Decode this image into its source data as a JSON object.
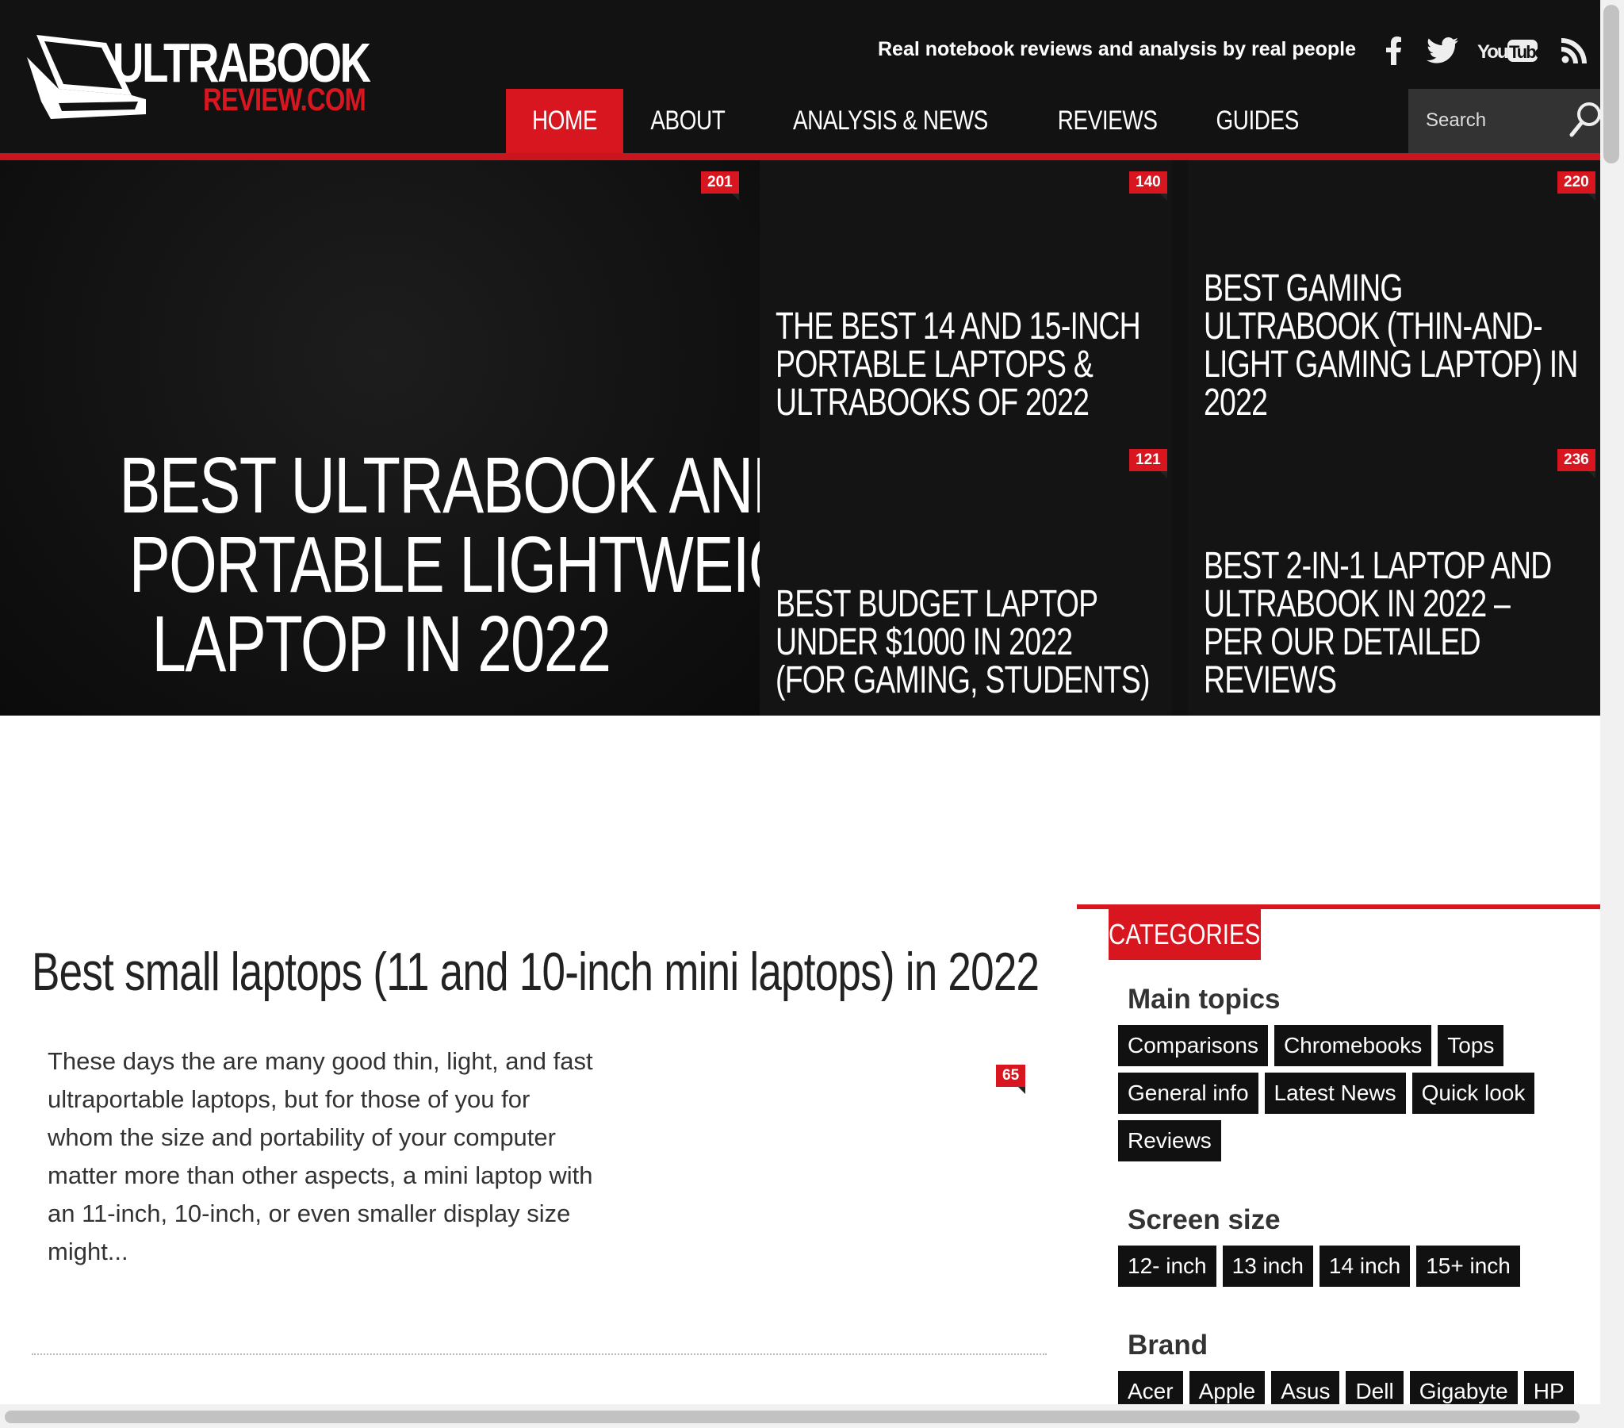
{
  "header": {
    "logo_line1": "ULTRABOOK",
    "logo_line2": "REVIEW.COM",
    "tagline": "Real notebook reviews and analysis by real people",
    "social_icons": [
      "facebook-icon",
      "twitter-icon",
      "youtube-icon",
      "rss-icon"
    ],
    "youtube_text": "YouTube"
  },
  "nav": {
    "items": [
      {
        "label": "HOME",
        "active": true
      },
      {
        "label": "ABOUT",
        "active": false
      },
      {
        "label": "ANALYSIS & NEWS",
        "active": false
      },
      {
        "label": "REVIEWS",
        "active": false
      },
      {
        "label": "GUIDES",
        "active": false
      }
    ]
  },
  "search": {
    "placeholder": "Search"
  },
  "hero": {
    "main": {
      "title_lines": [
        "BEST ULTRABOOK AND",
        "PORTABLE LIGHTWEIGHT",
        "LAPTOP IN 2022"
      ],
      "comments": "201"
    },
    "tiles": [
      {
        "title_lines": [
          "THE BEST 14 AND 15-INCH",
          "PORTABLE LAPTOPS &",
          "ULTRABOOKS OF 2022"
        ],
        "comments": "140"
      },
      {
        "title_lines": [
          "BEST GAMING",
          "ULTRABOOK (THIN-AND-",
          "LIGHT GAMING LAPTOP) IN",
          "2022"
        ],
        "comments": "220"
      },
      {
        "title_lines": [
          "BEST BUDGET LAPTOP",
          "UNDER $1000 IN 2022",
          "(FOR GAMING, STUDENTS)"
        ],
        "comments": "121"
      },
      {
        "title_lines": [
          "BEST 2-IN-1 LAPTOP AND",
          "ULTRABOOK IN 2022 –",
          "PER OUR DETAILED",
          "REVIEWS"
        ],
        "comments": "236"
      }
    ]
  },
  "article": {
    "title": "Best small laptops (11 and 10-inch mini laptops) in 2022",
    "excerpt_lines": [
      "These days the are many good thin, light, and fast",
      "ultraportable laptops, but for those of you for",
      "whom the size and portability of your computer",
      "matter more than other aspects, a mini laptop with",
      "an 11-inch, 10-inch, or even smaller display size",
      "might..."
    ],
    "comments": "65"
  },
  "sidebar": {
    "header": "CATEGORIES",
    "sections": [
      {
        "heading": "Main topics",
        "tags": [
          "Comparisons",
          "Chromebooks",
          "Tops",
          "General info",
          "Latest News",
          "Quick look",
          "Reviews"
        ]
      },
      {
        "heading": "Screen size",
        "tags": [
          "12- inch",
          "13 inch",
          "14 inch",
          "15+ inch"
        ]
      },
      {
        "heading": "Brand",
        "tags": [
          "Acer",
          "Apple",
          "Asus",
          "Dell",
          "Gigabyte",
          "HP"
        ]
      }
    ]
  },
  "colors": {
    "brand_red": "#d7161f",
    "header_bg": "#121212",
    "tag_bg": "#111111"
  }
}
